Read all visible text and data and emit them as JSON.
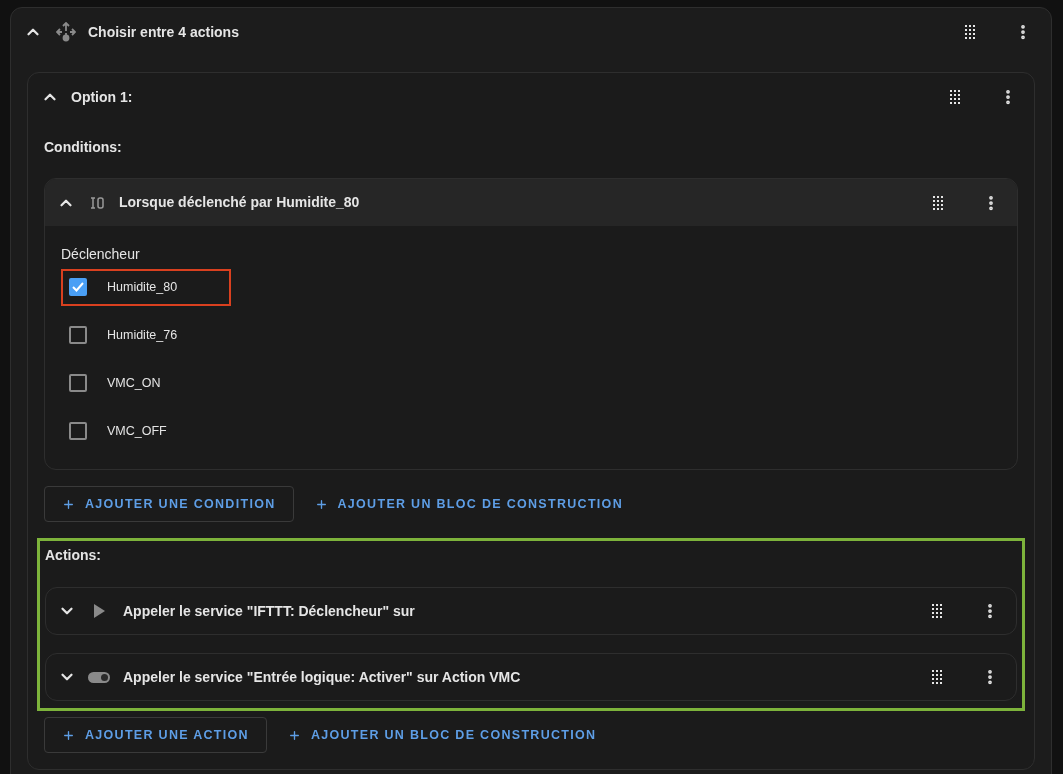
{
  "block": {
    "title": "Choisir entre 4 actions",
    "expanded": true
  },
  "option": {
    "title": "Option 1:",
    "expanded": true
  },
  "conditions": {
    "label": "Conditions:",
    "items": [
      {
        "title": "Lorsque déclenché par Humidite_80",
        "expanded": true,
        "field_label": "Déclencheur",
        "options": [
          {
            "label": "Humidite_80",
            "checked": true,
            "highlighted": true
          },
          {
            "label": "Humidite_76",
            "checked": false,
            "highlighted": false
          },
          {
            "label": "VMC_ON",
            "checked": false,
            "highlighted": false
          },
          {
            "label": "VMC_OFF",
            "checked": false,
            "highlighted": false
          }
        ]
      }
    ],
    "buttons": [
      {
        "kind": "outlined",
        "label": "AJOUTER UNE CONDITION"
      },
      {
        "kind": "text",
        "label": "AJOUTER UN BLOC DE CONSTRUCTION"
      }
    ]
  },
  "actions": {
    "label": "Actions:",
    "highlighted": true,
    "items": [
      {
        "kind": "play",
        "title": "Appeler le service \"IFTTT: Déclencheur\" sur",
        "expanded": false
      },
      {
        "kind": "toggle",
        "title": "Appeler le service \"Entrée logique: Activer\" sur Action VMC",
        "expanded": false
      }
    ],
    "buttons": [
      {
        "kind": "outlined",
        "label": "AJOUTER UNE ACTION"
      },
      {
        "kind": "text",
        "label": "AJOUTER UN BLOC DE CONSTRUCTION"
      }
    ]
  }
}
